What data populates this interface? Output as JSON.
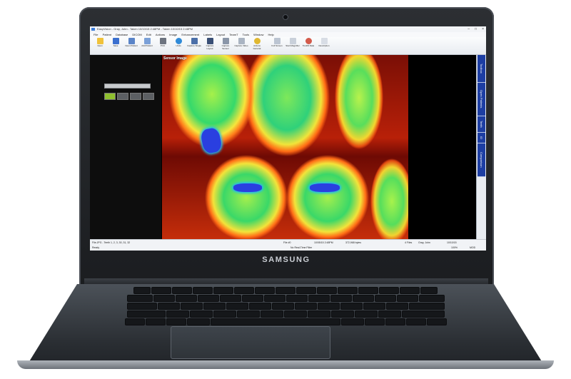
{
  "brand": "SAMSUNG",
  "app": {
    "title": "EasyVision - Gray, John - Taken 10/10/15 2:48PM - Taken 10/10/15 2:48PM",
    "menu": [
      "File",
      "Patient",
      "Database",
      "DICOM",
      "Edit",
      "Actions",
      "Image",
      "Enhancement",
      "Labels",
      "Layout",
      "TeamT",
      "Tools",
      "Window",
      "Help"
    ],
    "toolbar": [
      "Open",
      "Save",
      "Open Patient",
      "Add Patient",
      "Print",
      "Undo",
      "Capture Single",
      "Capture Layout",
      "Capture Sensor",
      "Capture Video",
      "Actions General",
      "Full Screen",
      "Start Magnifier",
      "Tooth# Data",
      "Description"
    ],
    "search_placeholder": "",
    "image_label": "Sensor Image",
    "side_tabs": [
      "Toolbox",
      "Open Patients",
      "Teeth",
      "ID",
      "Comparison"
    ],
    "status": {
      "left": "File.JPG - Teeth 1, 2, 3, 30, 31, 32",
      "ready": "Ready",
      "file_id": "File #0",
      "date": "10/05/15 2:48PM",
      "size": "372,968 bytes",
      "filter": "No Real-Time Filter",
      "files": "4 Files",
      "patient": "Gray, John",
      "taken": "10/10/15",
      "zoom": "100%",
      "mode": "MOD"
    }
  },
  "colors": {
    "sidetab_bg": "#1d3ea3",
    "xray_hot": "#ff7a1a",
    "xray_mid": "#35d96b",
    "restoration": "#2a3fe0"
  }
}
